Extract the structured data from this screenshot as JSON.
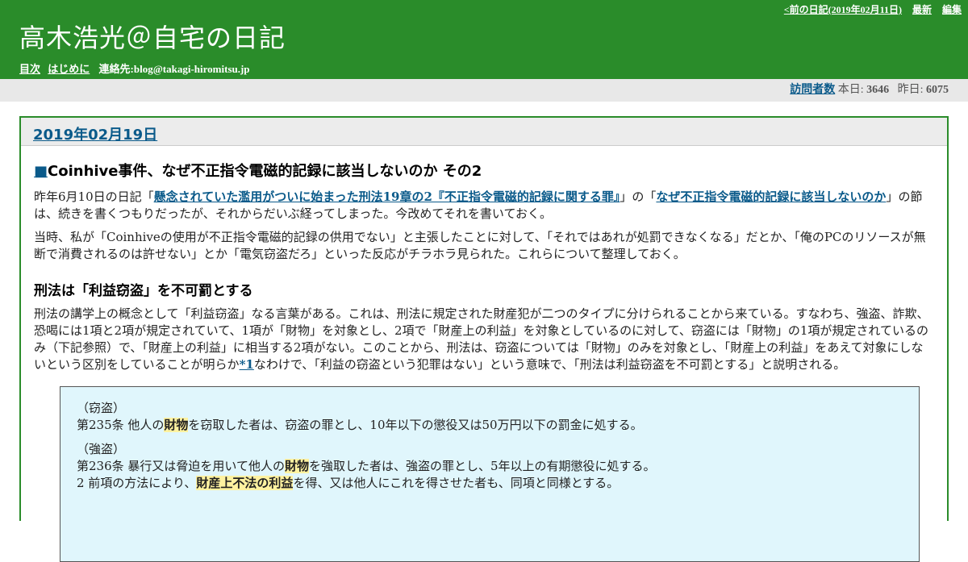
{
  "header": {
    "prev_link": "<前の日記(2019年02月11日)",
    "latest_link": "最新",
    "edit_link": "編集",
    "title": "高木浩光＠自宅の日記",
    "nav_toc": "目次",
    "nav_intro": "はじめに",
    "contact": "連絡先:blog@takagi-hiromitsu.jp"
  },
  "counter": {
    "link": "訪問者数",
    "today_label": "本日:",
    "today_value": "3646",
    "yesterday_label": "昨日:",
    "yesterday_value": "6075"
  },
  "entry": {
    "date": "2019年02月19日",
    "section_mark": "■",
    "section_title": "Coinhive事件、なぜ不正指令電磁的記録に該当しないのか その2",
    "p1_pre": "昨年6月10日の日記「",
    "p1_link1": "懸念されていた濫用がついに始まった刑法19章の2『不正指令電磁的記録に関する罪』",
    "p1_mid": "」の「",
    "p1_link2": "なぜ不正指令電磁的記録に該当しないのか",
    "p1_post": "」の節は、続きを書くつもりだったが、それからだいぶ経ってしまった。今改めてそれを書いておく。",
    "p2": "当時、私が「Coinhiveの使用が不正指令電磁的記録の供用でない」と主張したことに対して、「それではあれが処罰できなくなる」だとか、「俺のPCのリソースが無断で消費されるのは許せない」とか「電気窃盗だろ」といった反応がチラホラ見られた。これらについて整理しておく。",
    "subheading": "刑法は「利益窃盗」を不可罰とする",
    "p3_pre": "刑法の講学上の概念として「利益窃盗」なる言葉がある。これは、刑法に規定された財産犯が二つのタイプに分けられることから来ている。すなわち、強盗、詐欺、恐喝には1項と2項が規定されていて、1項が「財物」を対象とし、2項で「財産上の利益」を対象としているのに対して、窃盗には「財物」の1項が規定されているのみ（下記参照）で、「財産上の利益」に相当する2項がない。このことから、刑法は、窃盗については「財物」のみを対象とし、「財産上の利益」をあえて対象にしないという区別をしていることが明らか",
    "p3_footnote": "*1",
    "p3_post": "なわけで、「利益の窃盗という犯罪はない」という意味で、「刑法は利益窃盗を不可罰とする」と説明される。"
  },
  "law": {
    "theft_heading": "（窃盗）",
    "art235_pre": "第235条 他人の",
    "art235_hl": "財物",
    "art235_post": "を窃取した者は、窃盗の罪とし、10年以下の懲役又は50万円以下の罰金に処する。",
    "robbery_heading": "（強盗）",
    "art236_pre": "第236条 暴行又は脅迫を用いて他人の",
    "art236_hl": "財物",
    "art236_post": "を強取した者は、強盗の罪とし、5年以上の有期懲役に処する。",
    "art236_2_pre": "2 前項の方法により、",
    "art236_2_hl": "財産上不法の利益",
    "art236_2_post": "を得、又は他人にこれを得させた者も、同項と同様とする。"
  }
}
